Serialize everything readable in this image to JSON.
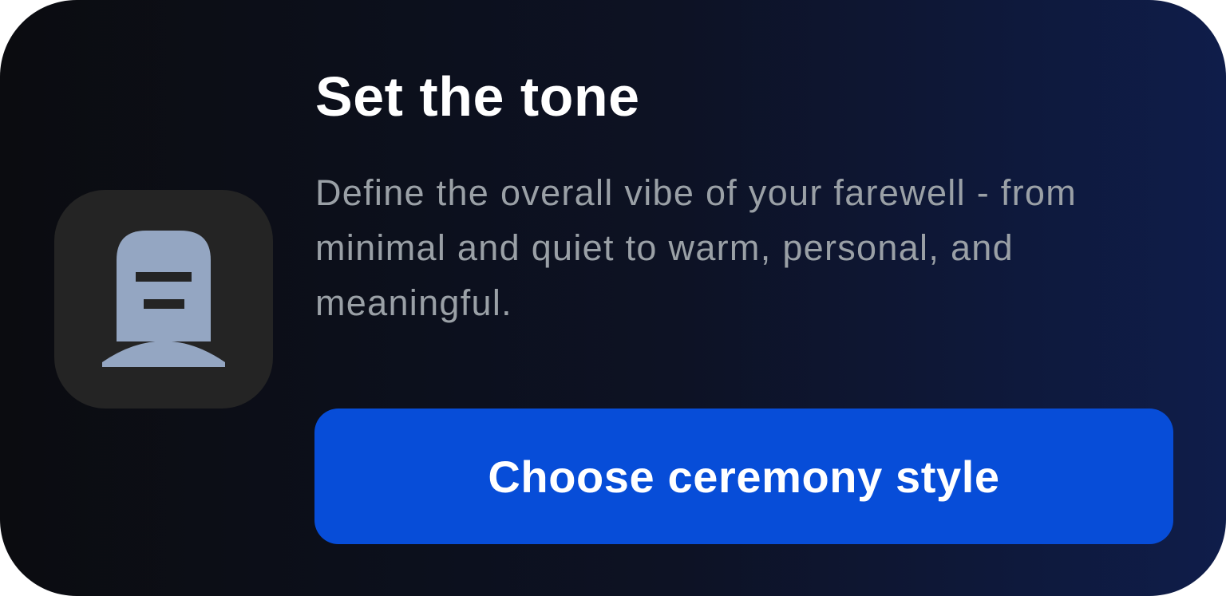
{
  "card": {
    "icon": "gravestone-icon",
    "title": "Set the tone",
    "description": "Define the overall vibe of your farewell - from minimal and quiet to warm, personal, and meaningful.",
    "button_label": "Choose ceremony style"
  },
  "colors": {
    "background_start": "#0b0c10",
    "background_end": "#0f1d4a",
    "icon_tile": "#242424",
    "icon_fill": "#94a6c2",
    "button": "#074dd8",
    "title_text": "#ffffff",
    "description_text": "#9aa0a6"
  }
}
